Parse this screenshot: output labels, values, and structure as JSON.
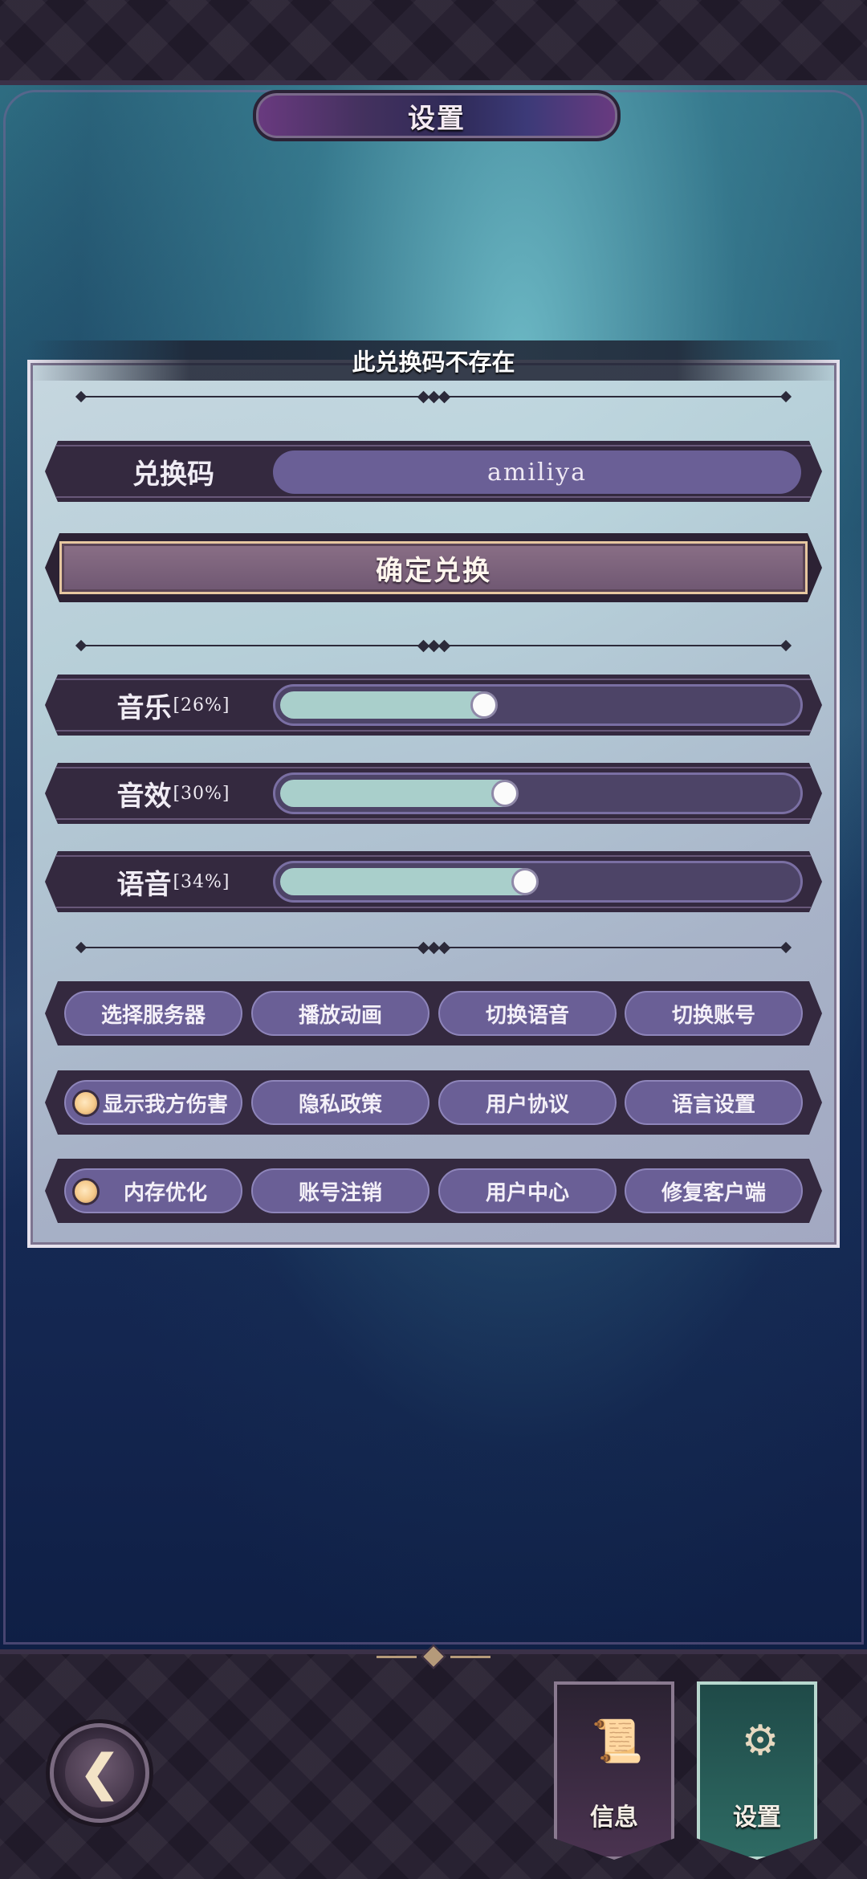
{
  "header": {
    "title": "设置"
  },
  "panel": {
    "notice": "此兑换码不存在",
    "redeem": {
      "label": "兑换码",
      "value": "amiliya",
      "confirm_label": "确定兑换"
    },
    "volume": [
      {
        "label": "音乐",
        "percent_text": "[26%]",
        "level": 0.26
      },
      {
        "label": "音效",
        "percent_text": "[30%]",
        "level": 0.3
      },
      {
        "label": "语音",
        "percent_text": "[34%]",
        "level": 0.34
      }
    ],
    "buttons_row1": [
      "选择服务器",
      "播放动画",
      "切换语音",
      "切换账号"
    ],
    "buttons_row2": [
      "显示我方伤害",
      "隐私政策",
      "用户协议",
      "语言设置"
    ],
    "buttons_row3": [
      "内存优化",
      "账号注销",
      "用户中心",
      "修复客户端"
    ]
  },
  "bottom_nav": {
    "back_icon": "back-arrow-icon",
    "tabs": [
      {
        "label": "信息",
        "icon": "scroll-icon",
        "active": false
      },
      {
        "label": "设置",
        "icon": "gears-icon",
        "active": true
      }
    ]
  },
  "colors": {
    "accent_pill": "#6a5f96",
    "slider_fill": "#a9cfcb",
    "active_tab": "#2e6a63"
  }
}
